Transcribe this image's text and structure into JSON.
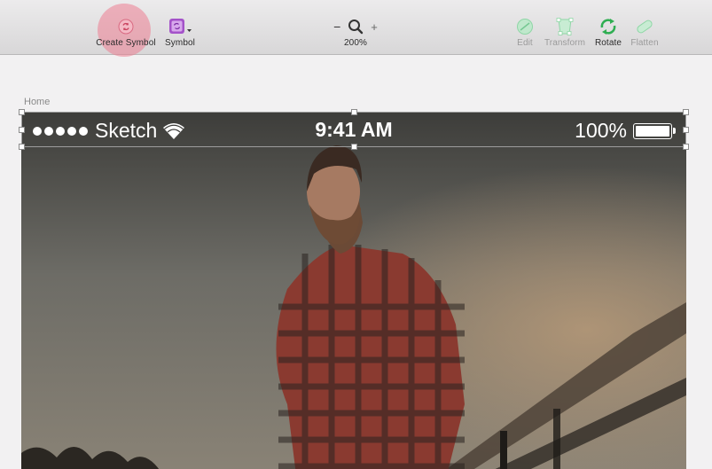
{
  "toolbar": {
    "create_symbol": "Create Symbol",
    "symbol": "Symbol",
    "zoom_minus": "−",
    "zoom_plus": "+",
    "zoom_level": "200%",
    "edit": "Edit",
    "transform": "Transform",
    "rotate": "Rotate",
    "flatten": "Flatten"
  },
  "canvas": {
    "artboard_name": "Home"
  },
  "status_bar": {
    "carrier": "Sketch",
    "time": "9:41 AM",
    "battery": "100%"
  },
  "colors": {
    "create_symbol_highlight": "#ec7e92",
    "symbol_purple": "#a452c9",
    "edit_green": "#8fd6a6",
    "rotate_green": "#2fae52"
  },
  "icons": {
    "create_symbol": "create-symbol-icon",
    "symbol": "symbol-icon",
    "zoom": "magnifier-icon",
    "edit": "edit-icon",
    "transform": "transform-icon",
    "rotate": "rotate-icon",
    "flatten": "flatten-icon",
    "wifi": "wifi-icon",
    "battery": "battery-icon"
  }
}
